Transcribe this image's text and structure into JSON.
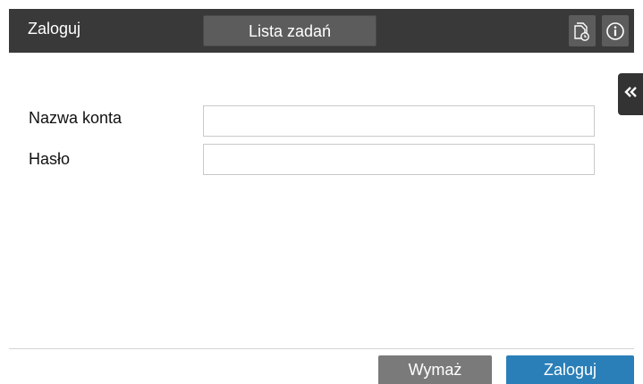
{
  "header": {
    "title": "Zaloguj",
    "job_list_label": "Lista zadań",
    "icons": [
      "job-history-icon",
      "info-icon"
    ]
  },
  "side_tab": {
    "icon": "double-chevron-left-icon"
  },
  "form": {
    "account_label": "Nazwa konta",
    "account_value": "",
    "password_label": "Hasło",
    "password_value": ""
  },
  "footer": {
    "clear_label": "Wymaż",
    "login_label": "Zaloguj"
  },
  "colors": {
    "topbar": "#393939",
    "button_gray": "#7a7a7a",
    "accent": "#2a7fb8"
  }
}
